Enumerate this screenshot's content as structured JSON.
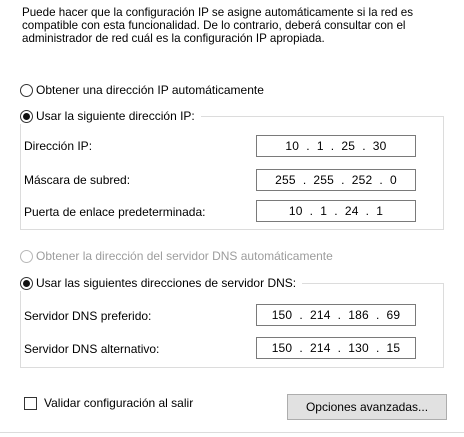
{
  "description": "Puede hacer que la configuración IP se asigne automáticamente si la red es compatible con esta funcionalidad. De lo contrario, deberá consultar con el administrador de red cuál es la configuración IP apropiada.",
  "ip": {
    "auto_label": "Obtener una dirección IP automáticamente",
    "manual_label": "Usar la siguiente dirección IP:",
    "selected": "manual",
    "fields": [
      {
        "label": "Dirección IP:",
        "value": "10  .  1  .  25  .  30"
      },
      {
        "label": "Máscara de subred:",
        "value": "255  .  255  .  252  .  0"
      },
      {
        "label": "Puerta de enlace predeterminada:",
        "value": "10  .  1  .  24  .  1"
      }
    ]
  },
  "dns": {
    "auto_label": "Obtener la dirección del servidor DNS automáticamente",
    "auto_disabled": true,
    "manual_label": "Usar las siguientes direcciones de servidor DNS:",
    "selected": "manual",
    "fields": [
      {
        "label": "Servidor DNS preferido:",
        "value": "150  .  214  .  186  .  69"
      },
      {
        "label": "Servidor DNS alternativo:",
        "value": "150  .  214  .  130  .  15"
      }
    ]
  },
  "validate_label": "Validar configuración al salir",
  "validate_checked": false,
  "advanced_button_label": "Opciones avanzadas..."
}
